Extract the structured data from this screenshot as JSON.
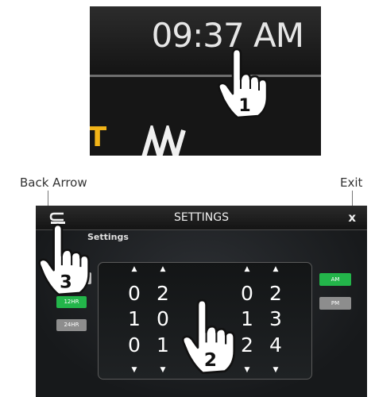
{
  "clock": {
    "time": "09:37 AM",
    "partial_text": "T"
  },
  "labels": {
    "back": "Back Arrow",
    "exit": "Exit"
  },
  "settings": {
    "title": "SETTINGS",
    "exit_glyph": "x",
    "subtitle": "Settings",
    "format_12": "12HR",
    "format_24": "24HR",
    "am": "AM",
    "pm": "PM",
    "picker_columns": [
      [
        "0",
        "1",
        "0"
      ],
      [
        "2",
        "0",
        "1"
      ],
      [
        "0",
        "1",
        "2"
      ],
      [
        "2",
        "3",
        "4"
      ]
    ],
    "selected_format": "12HR",
    "selected_period": "AM"
  },
  "steps": [
    "1",
    "2",
    "3"
  ],
  "colors": {
    "accent_green": "#23b54a",
    "inactive_gray": "#8d8d8d",
    "clock_yellow": "#f2b418"
  },
  "icons": [
    "pointing-hand-icon",
    "back-arrow-icon",
    "close-icon",
    "up-arrow-icon",
    "down-arrow-icon"
  ]
}
